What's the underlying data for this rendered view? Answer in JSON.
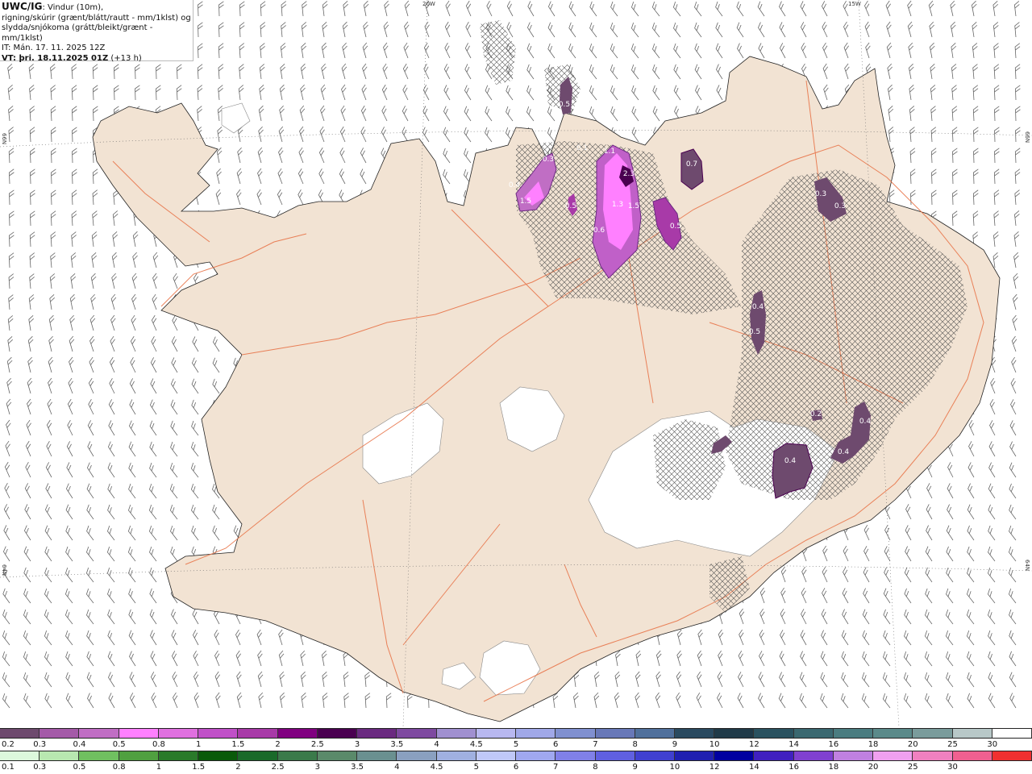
{
  "header": {
    "title": "UWC/IG",
    "line1_rest": ": Vindur (10m),",
    "line2": "rigning/skúrir (grænt/blátt/rautt - mm/1klst) og",
    "line3": "slydda/snjókoma (grátt/bleikt/grænt - mm/1klst)",
    "it": "IT: Mán. 17. 11. 2025 12Z",
    "vt_prefix": "VT: þri. 18.11.2025 01Z",
    "vt_offset": " (+13 h)"
  },
  "grid_labels": {
    "lon_20w": "20W",
    "lon_15w": "15W",
    "lat_66n_left": "66N",
    "lat_66n_right": "66N",
    "lat_64n_left": "64N",
    "lat_64n_right": "64N"
  },
  "precip_labels": [
    "0.5",
    "0.3",
    "0.4",
    "1.5",
    "0.1",
    "1.1",
    "2.3",
    "0.7",
    "0.3",
    "0.3",
    "1.3",
    "1.5",
    "0.5",
    "0.6",
    "0.5",
    "0.4",
    "0.5",
    "0.4",
    "0.4",
    "0.4",
    "0.2"
  ],
  "snow_scale": {
    "labels": [
      "0.2",
      "0.3",
      "0.4",
      "0.5",
      "0.8",
      "1",
      "1.5",
      "2",
      "2.5",
      "3",
      "3.5",
      "4",
      "4.5",
      "5",
      "6",
      "7",
      "8",
      "9",
      "10",
      "12",
      "14",
      "16",
      "18",
      "20",
      "25",
      "30"
    ],
    "colors": [
      "#6e4a6e",
      "#a45aa8",
      "#c06ec4",
      "#ff80ff",
      "#e070e0",
      "#c050c8",
      "#a83aa8",
      "#800080",
      "#4a0050",
      "#6a2a80",
      "#7e4aa0",
      "#a090d0",
      "#b8b8f0",
      "#a0a8e8",
      "#8090d0",
      "#6878b8",
      "#50709c",
      "#2a4a60",
      "#203a48",
      "#2a5260",
      "#3a6870",
      "#4a7c80",
      "#5a8a8a",
      "#7a9c9c",
      "#b8c8c8",
      "#ffffff"
    ]
  },
  "rain_scale": {
    "labels": [
      "0.1",
      "0.3",
      "0.5",
      "0.8",
      "1",
      "1.5",
      "2",
      "2.5",
      "3",
      "3.5",
      "4",
      "4.5",
      "5",
      "6",
      "7",
      "8",
      "9",
      "10",
      "12",
      "14",
      "16",
      "18",
      "20",
      "25",
      "30"
    ],
    "colors": [
      "#dcf8dc",
      "#b8e8b0",
      "#70c060",
      "#50a040",
      "#2a7a2a",
      "#0a5a0a",
      "#1a6a2a",
      "#3a7a4a",
      "#5a8a6a",
      "#6a9090",
      "#8aa0c0",
      "#a0b0e0",
      "#c0c8f8",
      "#a0a8f0",
      "#8080e8",
      "#6060e0",
      "#4040d0",
      "#2020b0",
      "#0000a0",
      "#4020c0",
      "#8040d0",
      "#c080e0",
      "#f0a0f0",
      "#f080c0",
      "#f06090",
      "#f03030"
    ]
  },
  "colors": {
    "land": "#f2e3d3",
    "sea": "#ffffff",
    "roads": "#e8754a",
    "glacier": "#ffffff"
  }
}
